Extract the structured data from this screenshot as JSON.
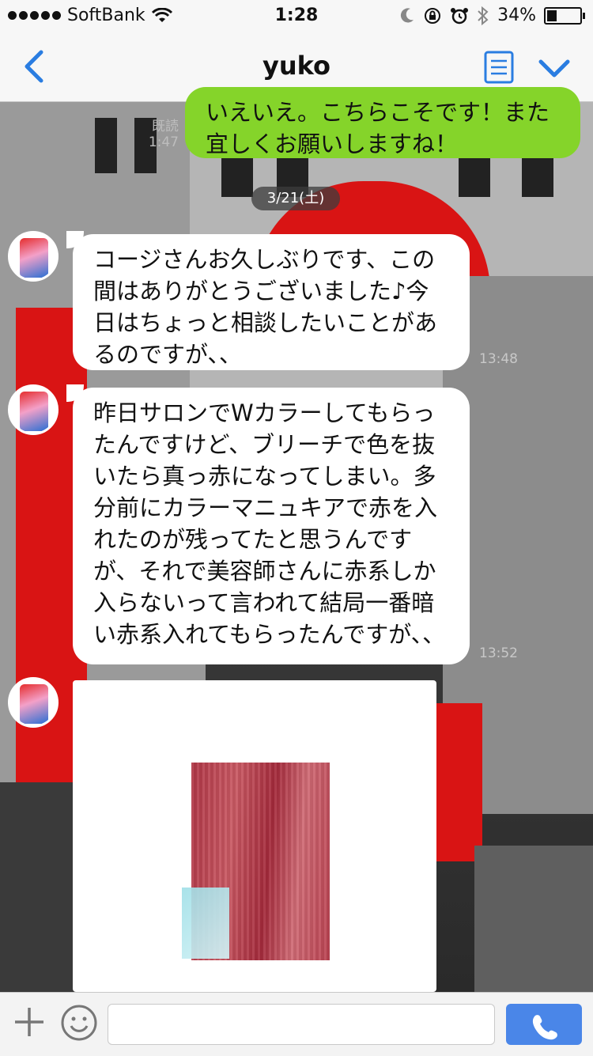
{
  "status_bar": {
    "carrier": "SoftBank",
    "time": "1:28",
    "battery_text": "34%",
    "battery_level": 0.34
  },
  "nav": {
    "title": "yuko",
    "icons": [
      "chevron-left-icon",
      "notes-icon",
      "chevron-down-icon"
    ]
  },
  "chat": {
    "date_label": "3/21(土)",
    "messages": [
      {
        "sender": "me",
        "text": "いえいえ。こちらこそです！また宜しくお願いしますね！",
        "read": "既読",
        "time": "1:47"
      },
      {
        "sender": "yuko",
        "text": "コージさんお久しぶりです、この間はありがとうございました♪今日はちょっと相談したいことがあるのですが、、",
        "time": "13:48"
      },
      {
        "sender": "yuko",
        "text": "昨日サロンでWカラーしてもらったんですけど、ブリーチで色を抜いたら真っ赤になってしまい。多分前にカラーマニュキアで赤を入れたのが残ってたと思うんですが、それで美容師さんに赤系しか入らないって言われて結局一番暗い赤系入れてもらったんですが、、",
        "time": "13:52"
      },
      {
        "sender": "yuko",
        "type": "image",
        "image_desc": "hair-photo"
      }
    ]
  },
  "input_bar": {
    "placeholder": "",
    "icons": [
      "plus-icon",
      "smiley-icon",
      "phone-icon"
    ]
  },
  "colors": {
    "accent": "#2a7de1",
    "my_bubble": "#85d42a",
    "call_button": "#4a86e8"
  }
}
